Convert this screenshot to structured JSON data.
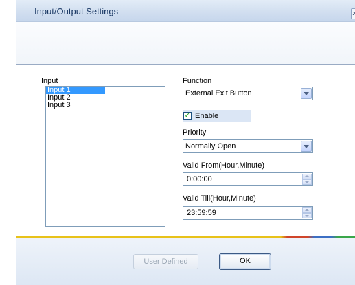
{
  "window": {
    "title": "Input/Output Settings",
    "close_label": "x"
  },
  "input": {
    "label": "Input",
    "items": [
      "Input 1",
      "Input 2",
      "Input 3"
    ],
    "selected_index": 0
  },
  "function": {
    "label": "Function",
    "value": "External Exit Button"
  },
  "enable": {
    "label": "Enable",
    "checked": true
  },
  "priority": {
    "label": "Priority",
    "value": "Normally Open"
  },
  "valid_from": {
    "label": "Valid From(Hour,Minute)",
    "value": "0:00:00"
  },
  "valid_till": {
    "label": "Valid Till(Hour,Minute)",
    "value": "23:59:59"
  },
  "buttons": {
    "user_defined": "User Defined",
    "ok": "OK"
  },
  "colors": {
    "selection": "#3399ff",
    "accent_yellow": "#e8c21a",
    "accent_red": "#d0452a",
    "accent_blue": "#3c6fc4",
    "accent_green": "#3aa64a"
  }
}
